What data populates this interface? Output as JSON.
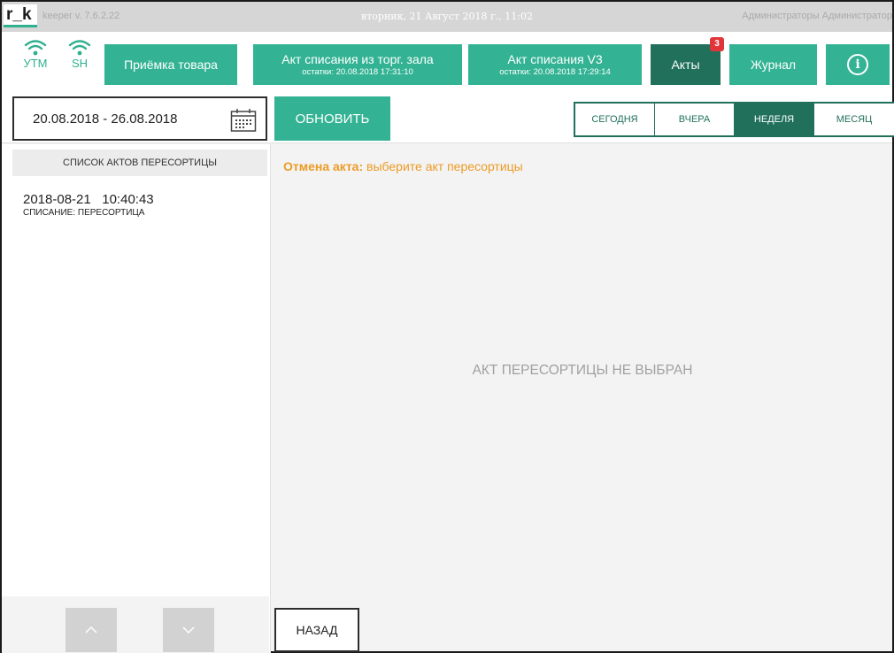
{
  "titlebar": {
    "logo": "r_k",
    "version": "keeper v. 7.6.2.22",
    "datetime": "вторник, 21 Август 2018 г., 11:02",
    "user": "Администраторы Администратор"
  },
  "status": {
    "utm_label": "УТМ",
    "sh_label": "SH",
    "icon": "wifi-icon",
    "color": "#2fb08e"
  },
  "toolbar": {
    "receive_label": "Приёмка товара",
    "writeoff_hall": {
      "label": "Акт списания из торг. зала",
      "sub": "остатки: 20.08.2018 17:31:10"
    },
    "writeoff_v3": {
      "label": "Акт списания V3",
      "sub": "остатки: 20.08.2018 17:29:14"
    },
    "acts_label": "Акты",
    "acts_badge": "3",
    "journal_label": "Журнал",
    "info_glyph": "i"
  },
  "filter": {
    "date_range": "20.08.2018 - 26.08.2018",
    "refresh_label": "ОБНОВИТЬ",
    "periods": [
      "СЕГОДНЯ",
      "ВЧЕРА",
      "НЕДЕЛЯ",
      "МЕСЯЦ"
    ],
    "active_period": "НЕДЕЛЯ"
  },
  "left": {
    "header": "СПИСОК АКТОВ ПЕРЕСОРТИЦЫ",
    "items": [
      {
        "date": "2018-08-21",
        "time": "10:40:43",
        "type": "СПИСАНИЕ: ПЕРЕСОРТИЦА"
      }
    ]
  },
  "main": {
    "cancel_prefix": "Отмена акта:",
    "cancel_text": "выберите акт пересортицы",
    "empty_message": "АКТ ПЕРЕСОРТИЦЫ НЕ ВЫБРАН",
    "back_label": "НАЗАД"
  },
  "colors": {
    "accent": "#33b394",
    "accent_dark": "#21705c",
    "warning": "#ec9b24",
    "badge": "#e0363a"
  }
}
